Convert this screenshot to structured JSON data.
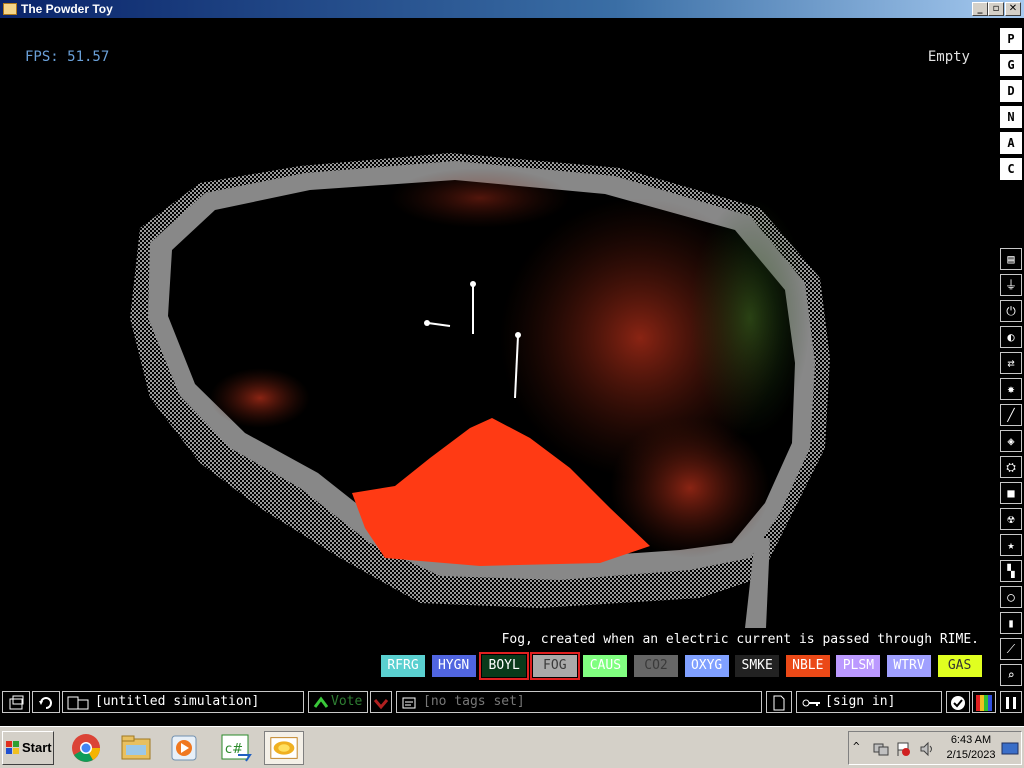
{
  "window": {
    "title": "The Powder Toy"
  },
  "hud": {
    "fps": "FPS: 51.57",
    "hover": "Empty",
    "tooltip": "Fog, created when an electric current is passed through RIME."
  },
  "side_menu": {
    "letters": [
      "P",
      "G",
      "D",
      "N",
      "A",
      "C"
    ],
    "categories": [
      "walls-icon",
      "electronics-icon",
      "powered-icon",
      "sensors-icon",
      "force-icon",
      "explosives-icon",
      "powders-icon",
      "liquids-icon",
      "gases-icon",
      "solids-icon",
      "radioactive-icon",
      "special-icon",
      "life-icon",
      "tools-icon",
      "favorites-icon",
      "decoration-icon",
      "search-icon",
      "pause-icon"
    ]
  },
  "elements": [
    {
      "label": "RFRG",
      "bg": "#5ad0d0",
      "fg": "#ffffff"
    },
    {
      "label": "HYGN",
      "bg": "#5065e0",
      "fg": "#ffffff"
    },
    {
      "label": "BOYL",
      "bg": "#0a3a1a",
      "fg": "#ffffff",
      "selected": true
    },
    {
      "label": "FOG",
      "bg": "#aaaaaa",
      "fg": "#3a3a3a",
      "selected": true
    },
    {
      "label": "CAUS",
      "bg": "#80ff80",
      "fg": "#ffffff"
    },
    {
      "label": "CO2",
      "bg": "#666666",
      "fg": "#3a3a3a"
    },
    {
      "label": "OXYG",
      "bg": "#80a0ff",
      "fg": "#ffffff"
    },
    {
      "label": "SMKE",
      "bg": "#222222",
      "fg": "#ffffff"
    },
    {
      "label": "NBLE",
      "bg": "#eb4917",
      "fg": "#ffffff"
    },
    {
      "label": "PLSM",
      "bg": "#bb99ff",
      "fg": "#ffffff"
    },
    {
      "label": "WTRV",
      "bg": "#a0a0ff",
      "fg": "#ffffff"
    },
    {
      "label": "GAS",
      "bg": "#e0ff20",
      "fg": "#333333"
    }
  ],
  "bottom_bar": {
    "sim_name": "[untitled simulation]",
    "vote": "Vote",
    "tags": "[no tags set]",
    "sign_in": "[sign in]"
  },
  "taskbar": {
    "start": "Start",
    "time": "6:43 AM",
    "date": "2/15/2023"
  }
}
